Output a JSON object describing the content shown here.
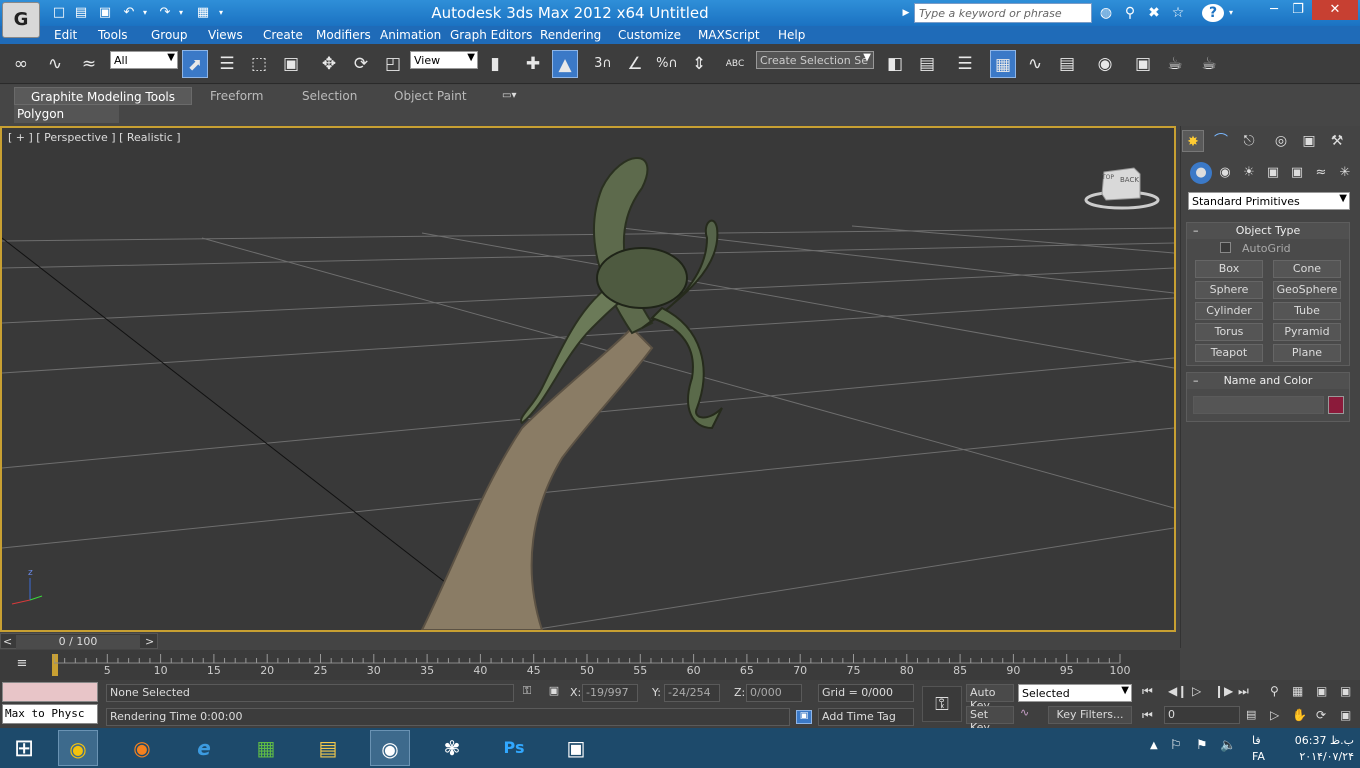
{
  "window": {
    "title": "Autodesk 3ds Max  2012 x64     Untitled",
    "app_logo": "G",
    "search_placeholder": "Type a keyword or phrase",
    "help_label": "?"
  },
  "menu": [
    "Edit",
    "Tools",
    "Group",
    "Views",
    "Create",
    "Modifiers",
    "Animation",
    "Graph Editors",
    "Rendering",
    "Customize",
    "MAXScript",
    "Help"
  ],
  "toolbar": {
    "selection_filter": "All",
    "ref_coord": "View",
    "selection_set_placeholder": "Create Selection Se",
    "snap_3": "3",
    "percent_snap": "%",
    "abc_label": "ABC"
  },
  "ribbon": {
    "tabs": [
      "Graphite Modeling Tools",
      "Freeform",
      "Selection",
      "Object Paint"
    ],
    "panel_label": "Polygon Modeling"
  },
  "viewport": {
    "label": "[ + ] [ Perspective ] [ Realistic ]",
    "viewcube_label": "BACK",
    "viewcube_side": "TOP",
    "axis_z": "z"
  },
  "command_panel": {
    "category_dropdown": "Standard Primitives",
    "object_type_title": "Object Type",
    "autogrid_label": "AutoGrid",
    "primitives": [
      "Box",
      "Cone",
      "Sphere",
      "GeoSphere",
      "Cylinder",
      "Tube",
      "Torus",
      "Pyramid",
      "Teapot",
      "Plane"
    ],
    "name_color_title": "Name and Color",
    "name_value": "",
    "swatch_color": "#8b1a3a"
  },
  "timeline": {
    "frame_counter": "0 / 100",
    "ticks": [
      "5",
      "10",
      "15",
      "20",
      "25",
      "30",
      "35",
      "40",
      "45",
      "50",
      "55",
      "60",
      "65",
      "70",
      "75",
      "80",
      "85",
      "90",
      "95",
      "100"
    ],
    "prev_label": "<",
    "next_label": ">"
  },
  "status": {
    "maxscript_mini": "Max to Physc",
    "selection_status": "None Selected",
    "prompt": "Rendering Time  0:00:00",
    "x_label": "X:",
    "x_value": "-19/997",
    "y_label": "Y:",
    "y_value": "-24/254",
    "z_label": "Z:",
    "z_value": "0/000",
    "grid": "Grid = 0/000",
    "add_time_tag": "Add Time Tag",
    "auto_key": "Auto Key",
    "set_key": "Set Key",
    "key_mode": "Selected",
    "key_filters": "Key Filters...",
    "current_frame": "0"
  },
  "taskbar": {
    "lang": "FA",
    "time": "06:37 ب.ظ",
    "date": "۲۰۱۴/۰۷/۲۴",
    "lang_small": "فا",
    "ps_label": "Ps"
  }
}
